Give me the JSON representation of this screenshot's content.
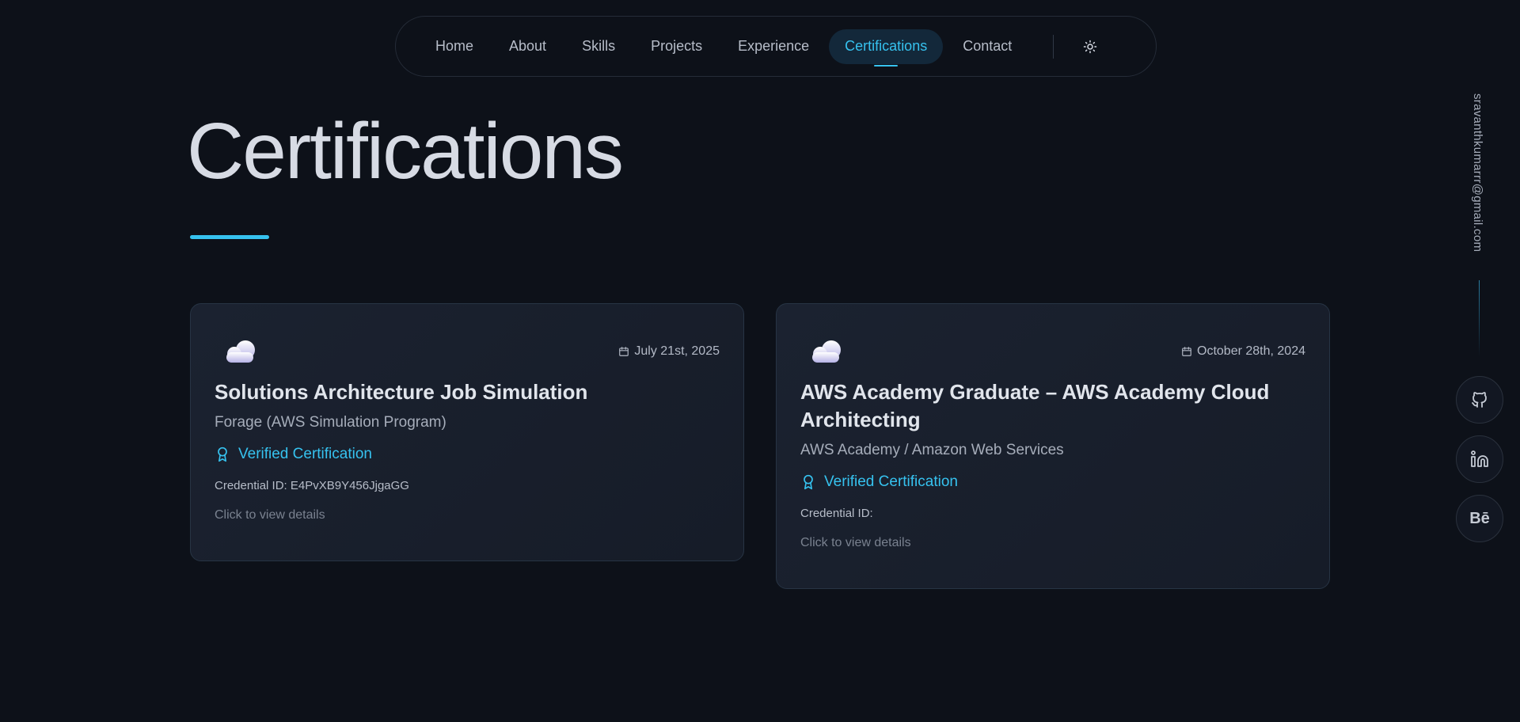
{
  "nav": {
    "items": [
      {
        "label": "Home"
      },
      {
        "label": "About"
      },
      {
        "label": "Skills"
      },
      {
        "label": "Projects"
      },
      {
        "label": "Experience"
      },
      {
        "label": "Certifications",
        "active": true
      },
      {
        "label": "Contact"
      }
    ],
    "theme_toggle_icon": "sun-icon"
  },
  "page": {
    "title": "Certifications"
  },
  "certifications": [
    {
      "icon": "cloud-icon",
      "date": "July 21st, 2025",
      "title": "Solutions Architecture Job Simulation",
      "issuer": "Forage (AWS Simulation Program)",
      "verified_label": "Verified Certification",
      "credential": "Credential ID: E4PvXB9Y456JjgaGG",
      "cta": "Click to view details"
    },
    {
      "icon": "cloud-icon",
      "date": "October 28th, 2024",
      "title": "AWS Academy Graduate – AWS Academy Cloud Architecting",
      "issuer": "AWS Academy / Amazon Web Services",
      "verified_label": "Verified Certification",
      "credential": "Credential ID:",
      "cta": "Click to view details"
    }
  ],
  "rail": {
    "email": "sravanthkumarrr@gmail.com",
    "socials": [
      {
        "icon": "github-icon"
      },
      {
        "icon": "linkedin-icon"
      },
      {
        "icon": "behance-icon",
        "text": "Bē"
      }
    ]
  },
  "colors": {
    "background": "#0d1119",
    "accent": "#36c2ef",
    "card": "#1b2230"
  }
}
